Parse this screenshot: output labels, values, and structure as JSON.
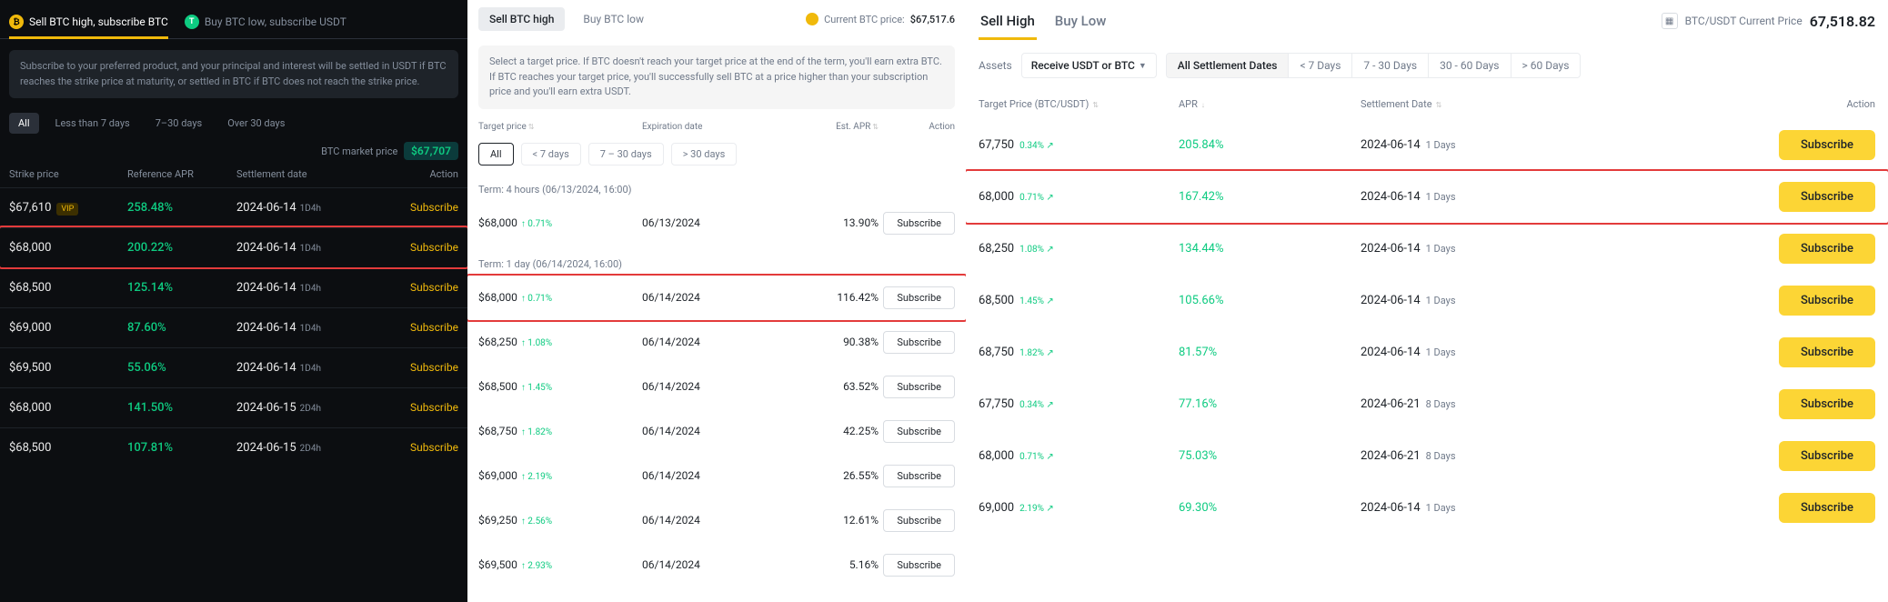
{
  "panel1": {
    "tabs": [
      {
        "label": "Sell BTC high, subscribe BTC",
        "active": true
      },
      {
        "label": "Buy BTC low, subscribe USDT",
        "active": false
      }
    ],
    "note": "Subscribe to your preferred product, and your principal and interest will be settled in USDT if BTC reaches the strike price at maturity, or settled in BTC if BTC does not reach the strike price.",
    "filters": [
      "All",
      "Less than 7 days",
      "7–30 days",
      "Over 30 days"
    ],
    "filter_active": 0,
    "market_label": "BTC market price",
    "market_price": "$67,707",
    "headers": [
      "Strike price",
      "Reference APR",
      "Settlement date",
      "Action"
    ],
    "subscribe_label": "Subscribe",
    "rows": [
      {
        "strike": "$67,610",
        "vip": "VIP",
        "apr": "258.48%",
        "date": "2024-06-14",
        "days": "1D4h",
        "highlight": false
      },
      {
        "strike": "$68,000",
        "vip": null,
        "apr": "200.22%",
        "date": "2024-06-14",
        "days": "1D4h",
        "highlight": true
      },
      {
        "strike": "$68,500",
        "vip": null,
        "apr": "125.14%",
        "date": "2024-06-14",
        "days": "1D4h",
        "highlight": false
      },
      {
        "strike": "$69,000",
        "vip": null,
        "apr": "87.60%",
        "date": "2024-06-14",
        "days": "1D4h",
        "highlight": false
      },
      {
        "strike": "$69,500",
        "vip": null,
        "apr": "55.06%",
        "date": "2024-06-14",
        "days": "1D4h",
        "highlight": false
      },
      {
        "strike": "$68,000",
        "vip": null,
        "apr": "141.50%",
        "date": "2024-06-15",
        "days": "2D4h",
        "highlight": false
      },
      {
        "strike": "$68,500",
        "vip": null,
        "apr": "107.81%",
        "date": "2024-06-15",
        "days": "2D4h",
        "highlight": false
      }
    ]
  },
  "panel2": {
    "tabs": [
      {
        "label": "Sell BTC high",
        "active": true
      },
      {
        "label": "Buy BTC low",
        "active": false
      }
    ],
    "current_label": "Current BTC price:",
    "current_price": "$67,517.6",
    "note": "Select a target price. If BTC doesn't reach your target price at the end of the term, you'll earn extra BTC. If BTC reaches your target price, you'll successfully sell BTC at a price higher than your subscription price and you'll earn extra USDT.",
    "headers": [
      "Target price",
      "Expiration date",
      "Est. APR",
      "Action"
    ],
    "filters": [
      "All",
      "< 7 days",
      "7 – 30 days",
      "> 30 days"
    ],
    "filter_active": 0,
    "subscribe_label": "Subscribe",
    "groups": [
      {
        "term": "Term: 4 hours (06/13/2024, 16:00)",
        "rows": [
          {
            "tp": "$68,000",
            "pct": "↑ 0.71%",
            "exp": "06/13/2024",
            "apr": "13.90%",
            "highlight": false
          }
        ]
      },
      {
        "term": "Term: 1 day (06/14/2024, 16:00)",
        "rows": [
          {
            "tp": "$68,000",
            "pct": "↑ 0.71%",
            "exp": "06/14/2024",
            "apr": "116.42%",
            "highlight": true
          },
          {
            "tp": "$68,250",
            "pct": "↑ 1.08%",
            "exp": "06/14/2024",
            "apr": "90.38%",
            "highlight": false
          },
          {
            "tp": "$68,500",
            "pct": "↑ 1.45%",
            "exp": "06/14/2024",
            "apr": "63.52%",
            "highlight": false
          },
          {
            "tp": "$68,750",
            "pct": "↑ 1.82%",
            "exp": "06/14/2024",
            "apr": "42.25%",
            "highlight": false
          },
          {
            "tp": "$69,000",
            "pct": "↑ 2.19%",
            "exp": "06/14/2024",
            "apr": "26.55%",
            "highlight": false
          },
          {
            "tp": "$69,250",
            "pct": "↑ 2.56%",
            "exp": "06/14/2024",
            "apr": "12.61%",
            "highlight": false
          },
          {
            "tp": "$69,500",
            "pct": "↑ 2.93%",
            "exp": "06/14/2024",
            "apr": "5.16%",
            "highlight": false
          }
        ]
      }
    ]
  },
  "panel3": {
    "tabs": [
      {
        "label": "Sell High",
        "active": true
      },
      {
        "label": "Buy Low",
        "active": false
      }
    ],
    "price_label": "BTC/USDT Current Price",
    "price_value": "67,518.82",
    "assets_label": "Assets",
    "dropdown_value": "Receive USDT or BTC",
    "settle_tabs": [
      "All Settlement Dates",
      "< 7 Days",
      "7 - 30 Days",
      "30 - 60 Days",
      "> 60 Days"
    ],
    "settle_active": 0,
    "headers": [
      "Target Price (BTC/USDT)",
      "APR",
      "Settlement Date",
      "Action"
    ],
    "subscribe_label": "Subscribe",
    "rows": [
      {
        "tp": "67,750",
        "pct": "0.34% ↗",
        "apr": "205.84%",
        "date": "2024-06-14",
        "days": "1 Days",
        "highlight": false
      },
      {
        "tp": "68,000",
        "pct": "0.71% ↗",
        "apr": "167.42%",
        "date": "2024-06-14",
        "days": "1 Days",
        "highlight": true
      },
      {
        "tp": "68,250",
        "pct": "1.08% ↗",
        "apr": "134.44%",
        "date": "2024-06-14",
        "days": "1 Days",
        "highlight": false
      },
      {
        "tp": "68,500",
        "pct": "1.45% ↗",
        "apr": "105.66%",
        "date": "2024-06-14",
        "days": "1 Days",
        "highlight": false
      },
      {
        "tp": "68,750",
        "pct": "1.82% ↗",
        "apr": "81.57%",
        "date": "2024-06-14",
        "days": "1 Days",
        "highlight": false
      },
      {
        "tp": "67,750",
        "pct": "0.34% ↗",
        "apr": "77.16%",
        "date": "2024-06-21",
        "days": "8 Days",
        "highlight": false
      },
      {
        "tp": "68,000",
        "pct": "0.71% ↗",
        "apr": "75.03%",
        "date": "2024-06-21",
        "days": "8 Days",
        "highlight": false
      },
      {
        "tp": "69,000",
        "pct": "2.19% ↗",
        "apr": "69.30%",
        "date": "2024-06-14",
        "days": "1 Days",
        "highlight": false
      }
    ]
  }
}
